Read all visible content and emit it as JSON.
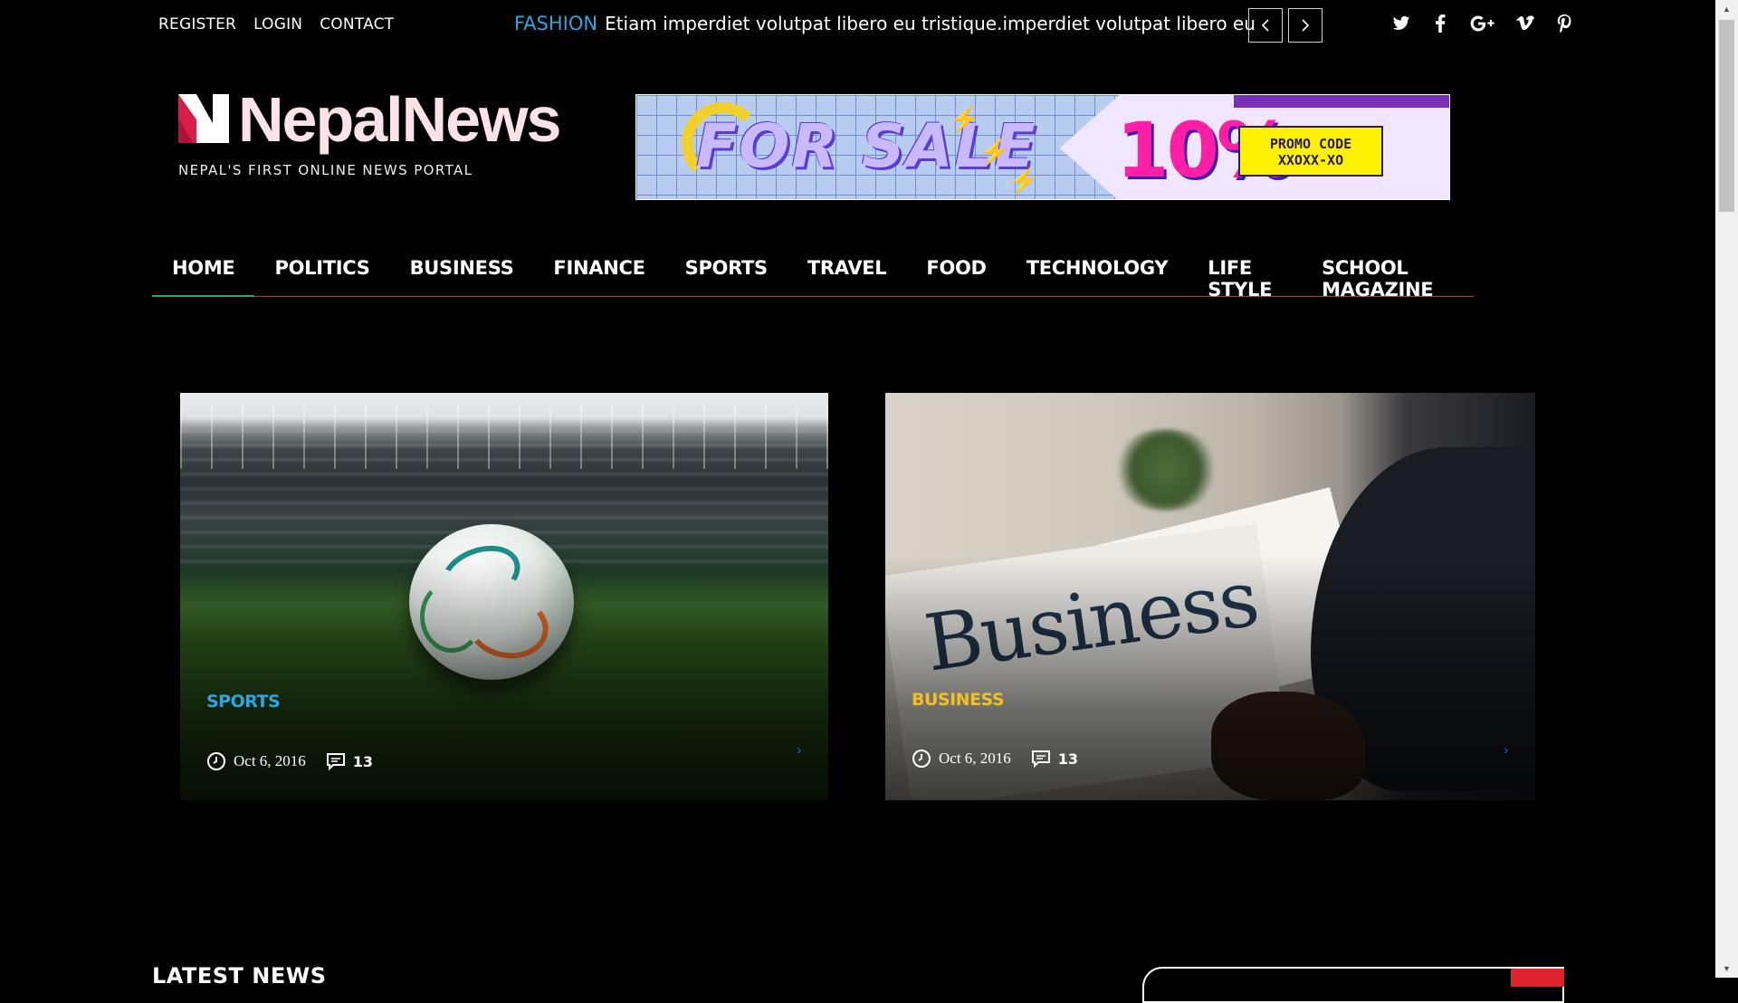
{
  "topbar": {
    "links": [
      "REGISTER",
      "LOGIN",
      "CONTACT"
    ],
    "ticker_tag": "FASHION",
    "ticker_text": "Etiam imperdiet volutpat libero eu tristique.imperdiet volutpat libero eu",
    "social_icons": [
      "twitter-icon",
      "facebook-icon",
      "google-plus-icon",
      "vimeo-icon",
      "pinterest-icon"
    ]
  },
  "logo": {
    "name": "NepalNews",
    "tagline": "NEPAL'S FIRST ONLINE NEWS PORTAL"
  },
  "ad": {
    "headline": "FOR SALE",
    "discount": "10%",
    "promo_line1": "PROMO CODE",
    "promo_line2": "XXOXX-XO"
  },
  "nav": {
    "items": [
      "HOME",
      "POLITICS",
      "BUSINESS",
      "FINANCE",
      "SPORTS",
      "TRAVEL",
      "FOOD",
      "TECHNOLOGY",
      "LIFE STYLE",
      "SCHOOL MAGAZINE"
    ],
    "active": "HOME"
  },
  "featured": [
    {
      "category": "SPORTS",
      "date": "Oct 6, 2016",
      "comments": "13"
    },
    {
      "category": "BUSINESS",
      "date": "Oct 6, 2016",
      "comments": "13"
    }
  ],
  "latest": {
    "title": "LATEST NEWS"
  },
  "colors": {
    "accent_red": "#e0242d",
    "sports_cat": "#2fa6e0",
    "business_cat": "#f3c020",
    "active_nav_underline": "#2aa56b"
  }
}
